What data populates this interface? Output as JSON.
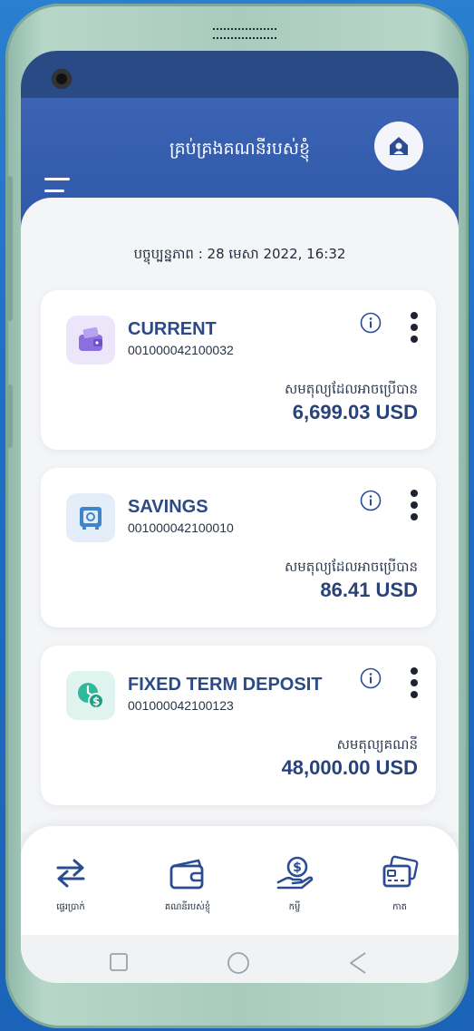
{
  "header": {
    "title": "គ្រប់គ្រងគណនីរបស់ខ្ញុំ"
  },
  "updated": "បច្ចុប្បន្នភាព : 28 មេសា 2022, 16:32",
  "accounts": [
    {
      "name": "CURRENT",
      "number": "001000042100032",
      "balance_label": "សមតុល្យដែលអាចប្រើបាន",
      "balance": "6,699.03 USD",
      "icon": "wallet-icon",
      "icon_bg": "#ece6fb",
      "icon_color": "#8b6fe0"
    },
    {
      "name": "SAVINGS",
      "number": "001000042100010",
      "balance_label": "សមតុល្យដែលអាចប្រើបាន",
      "balance": "86.41 USD",
      "icon": "safe-icon",
      "icon_bg": "#e4eef9",
      "icon_color": "#3e86c9"
    },
    {
      "name": "FIXED TERM DEPOSIT",
      "number": "001000042100123",
      "balance_label": "សមតុល្យគណនី",
      "balance": "48,000.00 USD",
      "icon": "clock-dollar-icon",
      "icon_bg": "#dff4ef",
      "icon_color": "#2fb89a"
    }
  ],
  "nav": [
    {
      "label": "ផ្ទេរប្រាក់",
      "icon": "transfer-icon"
    },
    {
      "label": "គណនីរបស់ខ្ញុំ",
      "icon": "wallet-icon"
    },
    {
      "label": "កម្ចី",
      "icon": "loan-icon"
    },
    {
      "label": "កាត",
      "icon": "card-icon"
    }
  ],
  "colors": {
    "primary": "#2f58a9",
    "navy_text": "#28427a",
    "nav_icon": "#2b4c93"
  }
}
